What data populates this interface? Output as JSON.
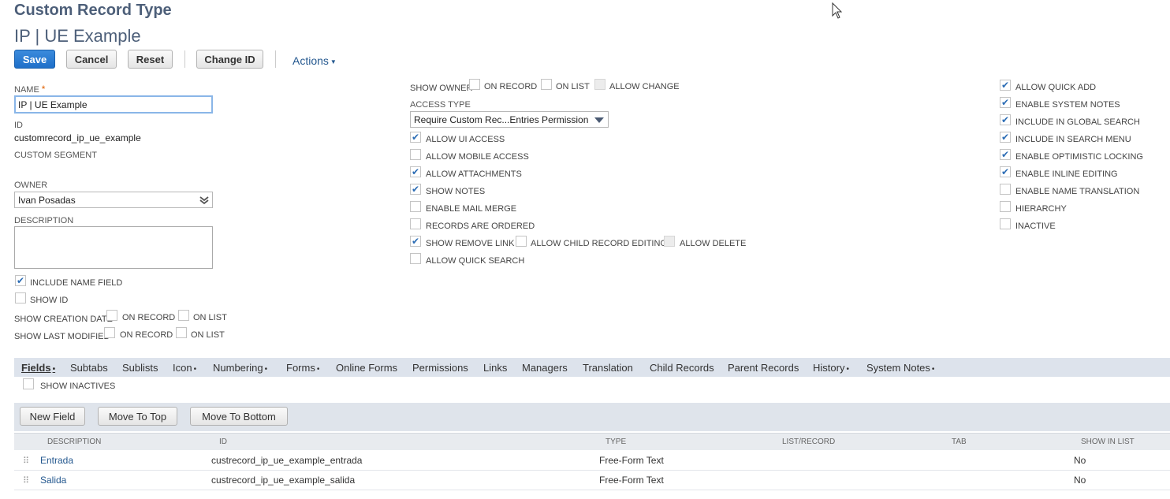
{
  "header": {
    "page_type": "Custom Record Type",
    "record_title": "IP | UE Example"
  },
  "buttons": {
    "save": "Save",
    "cancel": "Cancel",
    "reset": "Reset",
    "change_id": "Change ID",
    "actions": "Actions"
  },
  "form": {
    "name_label": "NAME",
    "name_value": "IP | UE Example",
    "id_label": "ID",
    "id_value": "customrecord_ip_ue_example",
    "custom_segment_label": "CUSTOM SEGMENT",
    "owner_label": "OWNER",
    "owner_value": "Ivan Posadas",
    "description_label": "DESCRIPTION",
    "include_name_field": "INCLUDE NAME FIELD",
    "show_id": "SHOW ID",
    "show_creation_date": "SHOW CREATION DATE",
    "show_last_modified": "SHOW LAST MODIFIED",
    "on_record": "ON RECORD",
    "on_list": "ON LIST",
    "show_owner": "SHOW OWNER",
    "allow_change": "ALLOW CHANGE",
    "access_type_label": "ACCESS TYPE",
    "access_type_value": "Require Custom Rec...Entries Permission"
  },
  "middle_checks": [
    {
      "label": "ALLOW UI ACCESS",
      "checked": true
    },
    {
      "label": "ALLOW MOBILE ACCESS",
      "checked": false
    },
    {
      "label": "ALLOW ATTACHMENTS",
      "checked": true
    },
    {
      "label": "SHOW NOTES",
      "checked": true
    },
    {
      "label": "ENABLE MAIL MERGE",
      "checked": false
    },
    {
      "label": "RECORDS ARE ORDERED",
      "checked": false
    },
    {
      "label": "SHOW REMOVE LINK",
      "checked": true
    },
    {
      "label": "ALLOW QUICK SEARCH",
      "checked": false
    }
  ],
  "remove_link_extra": {
    "allow_child_editing": "ALLOW CHILD RECORD EDITING",
    "allow_delete": "ALLOW DELETE"
  },
  "right_checks": [
    {
      "label": "ALLOW QUICK ADD",
      "checked": true
    },
    {
      "label": "ENABLE SYSTEM NOTES",
      "checked": true
    },
    {
      "label": "INCLUDE IN GLOBAL SEARCH",
      "checked": true
    },
    {
      "label": "INCLUDE IN SEARCH MENU",
      "checked": true
    },
    {
      "label": "ENABLE OPTIMISTIC LOCKING",
      "checked": true
    },
    {
      "label": "ENABLE INLINE EDITING",
      "checked": true
    },
    {
      "label": "ENABLE NAME TRANSLATION",
      "checked": false
    },
    {
      "label": "HIERARCHY",
      "checked": false
    },
    {
      "label": "INACTIVE",
      "checked": false
    }
  ],
  "tabs": [
    "Fields",
    "Subtabs",
    "Sublists",
    "Icon",
    "Numbering",
    "Forms",
    "Online Forms",
    "Permissions",
    "Links",
    "Managers",
    "Translation",
    "Child Records",
    "Parent Records",
    "History",
    "System Notes"
  ],
  "tab_dot": "•",
  "sublist": {
    "show_inactives": "SHOW INACTIVES",
    "new_field": "New Field",
    "move_top": "Move To Top",
    "move_bottom": "Move To Bottom",
    "columns": [
      "DESCRIPTION",
      "ID",
      "TYPE",
      "LIST/RECORD",
      "TAB",
      "SHOW IN LIST"
    ],
    "rows": [
      {
        "description": "Entrada",
        "id": "custrecord_ip_ue_example_entrada",
        "type": "Free-Form Text",
        "list_record": "",
        "tab": "",
        "show_in_list": "No"
      },
      {
        "description": "Salida",
        "id": "custrecord_ip_ue_example_salida",
        "type": "Free-Form Text",
        "list_record": "",
        "tab": "",
        "show_in_list": "No"
      }
    ]
  },
  "check_glyph": "✔",
  "drag_glyph": "⠿",
  "colors": {
    "accent": "#1e6fc9",
    "link": "#24588f",
    "title": "#4d5f79",
    "tab_bar": "#dde3ec"
  }
}
